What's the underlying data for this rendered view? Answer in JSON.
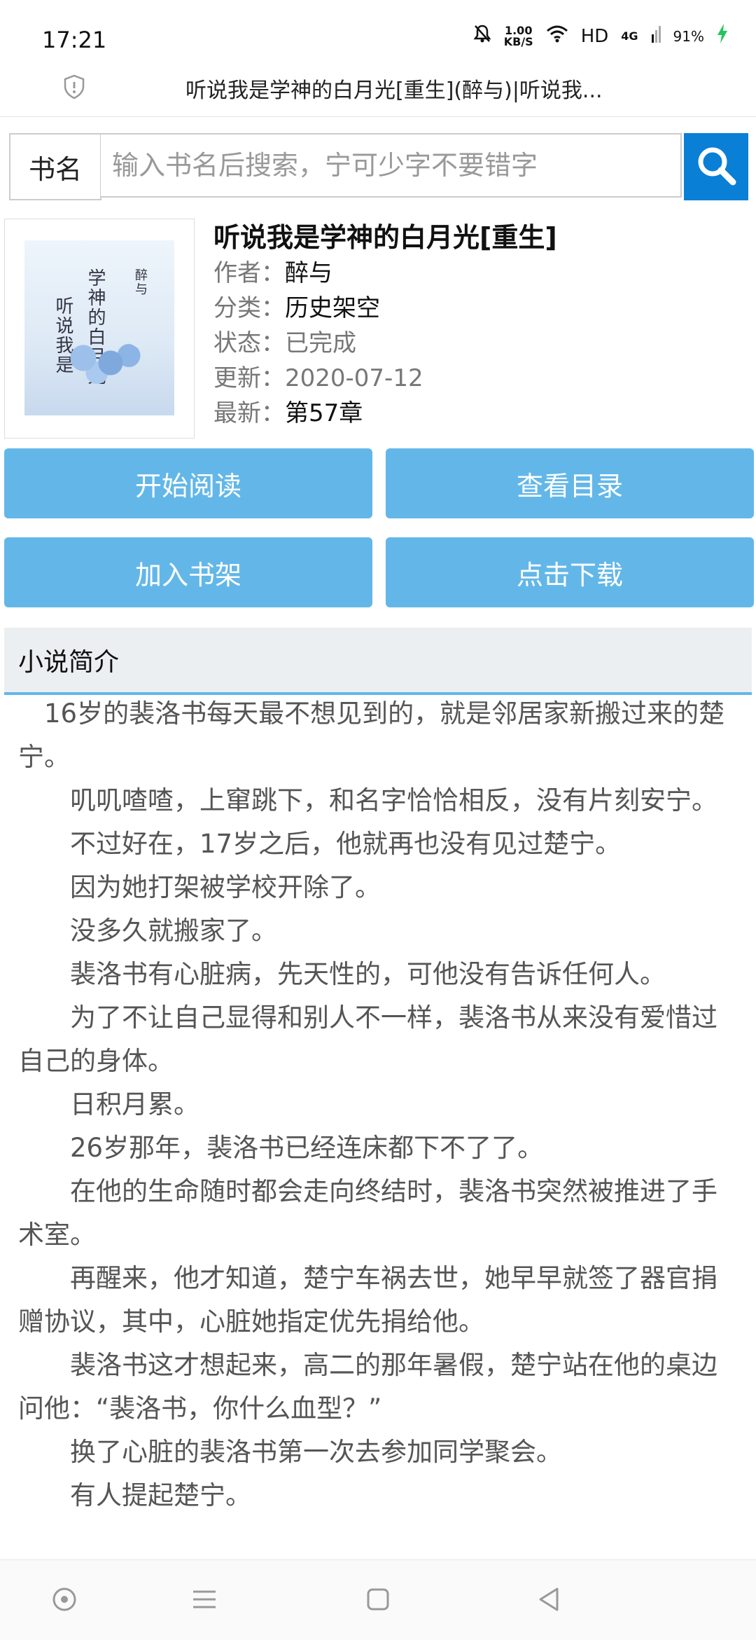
{
  "status": {
    "time": "17:21",
    "net_speed_value": "1.00",
    "net_speed_unit": "KB/S",
    "hd": "HD",
    "signal": "4G",
    "battery": "91%"
  },
  "browser": {
    "title": "听说我是学神的白月光[重生](醉与)|听说我..."
  },
  "search": {
    "label": "书名",
    "placeholder": "输入书名后搜索，宁可少字不要错字"
  },
  "book": {
    "title": "听说我是学神的白月光[重生]",
    "cover_text_main": "听说我是",
    "cover_text_sub": "学神的白月光",
    "cover_author": "醉与",
    "meta": [
      {
        "label": "作者：",
        "value": "醉与"
      },
      {
        "label": "分类：",
        "value": "历史架空"
      },
      {
        "label": "状态：",
        "value": "已完成"
      },
      {
        "label": "更新：",
        "value": "2020-07-12"
      },
      {
        "label": "最新：",
        "value": "第57章"
      }
    ]
  },
  "buttons": {
    "start_reading": "开始阅读",
    "view_catalog": "查看目录",
    "add_shelf": "加入书架",
    "download": "点击下载"
  },
  "intro": {
    "heading": "小说简介",
    "paragraphs": [
      "16岁的裴洛书每天最不想见到的，就是邻居家新搬过来的楚宁。",
      "叽叽喳喳，上窜跳下，和名字恰恰相反，没有片刻安宁。",
      "不过好在，17岁之后，他就再也没有见过楚宁。",
      "因为她打架被学校开除了。",
      "没多久就搬家了。",
      "裴洛书有心脏病，先天性的，可他没有告诉任何人。",
      "为了不让自己显得和别人不一样，裴洛书从来没有爱惜过自己的身体。",
      "日积月累。",
      "26岁那年，裴洛书已经连床都下不了了。",
      "在他的生命随时都会走向终结时，裴洛书突然被推进了手术室。",
      "再醒来，他才知道，楚宁车祸去世，她早早就签了器官捐赠协议，其中，心脏她指定优先捐给他。",
      "裴洛书这才想起来，高二的那年暑假，楚宁站在他的桌边问他：“裴洛书，你什么血型？”",
      "换了心脏的裴洛书第一次去参加同学聚会。",
      "有人提起楚宁。"
    ]
  }
}
